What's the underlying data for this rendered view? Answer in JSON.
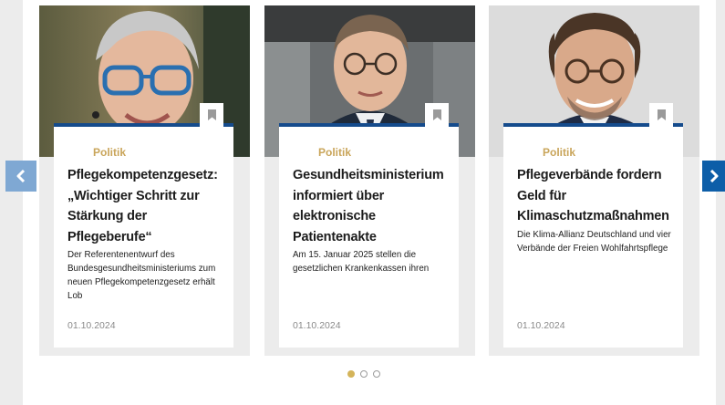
{
  "carousel": {
    "cards": [
      {
        "category": "Politik",
        "headline": "Pflegekompetenzgesetz: „Wichtiger Schritt zur Stärkung der Pflegeberufe“",
        "teaser": "Der Referentenentwurf des Bundesgesundheitsministeriums zum neuen Pflegekompetenzgesetz erhält Lob",
        "date": "01.10.2024"
      },
      {
        "category": "Politik",
        "headline": "Gesundheitsministerium informiert über elektronische Patientenakte",
        "teaser": "Am 15. Januar 2025 stellen die gesetzlichen Krankenkassen ihren",
        "date": "01.10.2024"
      },
      {
        "category": "Politik",
        "headline": "Pflegeverbände fordern Geld für Klimaschutzmaßnahmen",
        "teaser": "Die Klima-Allianz Deutschland und vier Verbände der Freien Wohlfahrtspflege",
        "date": "01.10.2024"
      }
    ],
    "pagination": {
      "pages": 3,
      "active": 1
    },
    "icons": {
      "prev": "chevron-left-icon",
      "next": "chevron-right-icon",
      "bookmark": "bookmark-icon"
    }
  },
  "colors": {
    "accent_blue": "#154b8c",
    "category_gold": "#c9a55a",
    "active_dot": "#d4b45a",
    "nav_prev": "#7fa8d3",
    "nav_next": "#0d5ea8"
  }
}
